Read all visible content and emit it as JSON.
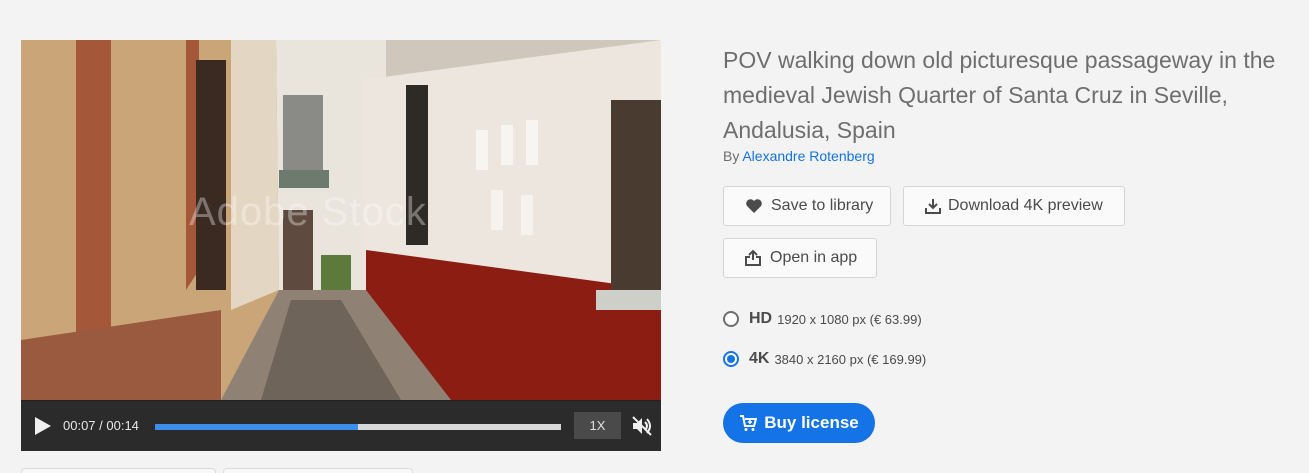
{
  "video": {
    "watermark": "Adobe Stock",
    "time_display": "00:07 / 00:14",
    "progress_fraction": 0.5,
    "speed_label": "1X",
    "play_icon": "play-icon",
    "mute_icon": "muted-speaker-icon"
  },
  "asset": {
    "title": "POV walking down old picturesque passageway in the medieval Jewish Quarter of Santa Cruz in Seville, Andalusia, Spain",
    "by_label": "By",
    "author": "Alexandre Rotenberg"
  },
  "actions": {
    "save_label": "Save to library",
    "download_label": "Download 4K preview",
    "open_label": "Open in app"
  },
  "options": [
    {
      "name": "HD",
      "detail": "1920 x 1080 px (€ 63.99)",
      "selected": false
    },
    {
      "name": "4K",
      "detail": "3840 x 2160 px (€ 169.99)",
      "selected": true
    }
  ],
  "buy": {
    "label": "Buy license"
  },
  "colors": {
    "accent": "#1473e6",
    "progress": "#3d8ee8"
  }
}
